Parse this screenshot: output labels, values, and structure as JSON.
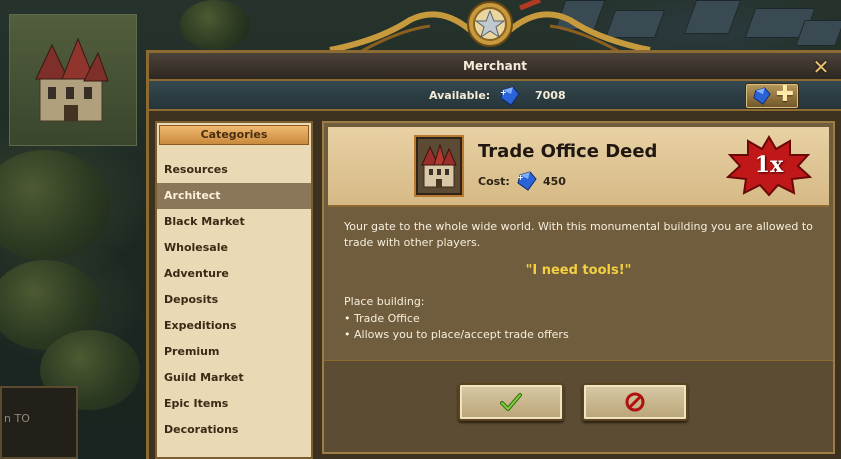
{
  "window": {
    "title": "Merchant",
    "close_icon": "close-icon"
  },
  "available": {
    "label": "Available:",
    "icon": "gem-icon",
    "value": "7008",
    "buy_icon": "plus-icon"
  },
  "categories": {
    "header": "Categories",
    "items": [
      {
        "label": "Resources",
        "active": false
      },
      {
        "label": "Architect",
        "active": true
      },
      {
        "label": "Black Market",
        "active": false
      },
      {
        "label": "Wholesale",
        "active": false
      },
      {
        "label": "Adventure",
        "active": false
      },
      {
        "label": "Deposits",
        "active": false
      },
      {
        "label": "Expeditions",
        "active": false
      },
      {
        "label": "Premium",
        "active": false
      },
      {
        "label": "Guild Market",
        "active": false
      },
      {
        "label": "Epic Items",
        "active": false
      },
      {
        "label": "Decorations",
        "active": false
      }
    ]
  },
  "item": {
    "name": "Trade Office Deed",
    "cost_label": "Cost:",
    "cost_value": "450",
    "quantity": "1x",
    "description": "Your gate to the whole wide world. With this monumental building you are allowed to trade with other players.",
    "quote": "\"I need tools!\"",
    "place_title": "Place building:",
    "bullets": [
      "Trade Office",
      "Allows you to place/accept trade offers"
    ]
  },
  "side_box": {
    "text": "n TO"
  },
  "colors": {
    "accent_gold": "#8c6a32",
    "quote_yellow": "#f4d040",
    "active_category": "#8b7659",
    "badge_red": "#c01818"
  }
}
